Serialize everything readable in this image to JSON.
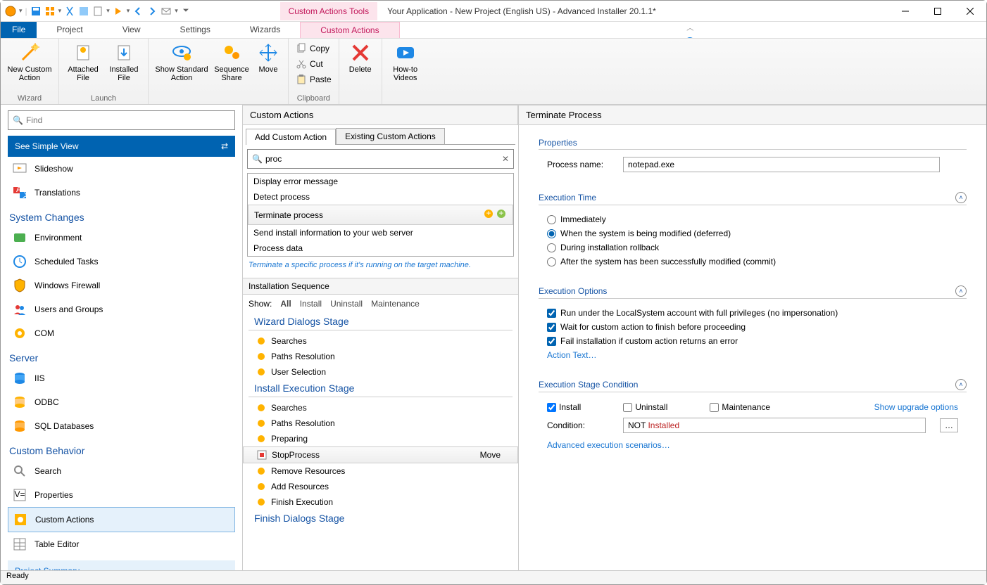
{
  "window": {
    "tools_tab": "Custom Actions Tools",
    "title": "Your Application - New Project (English US) - Advanced Installer 20.1.1*"
  },
  "menu": {
    "file": "File",
    "project": "Project",
    "view": "View",
    "settings": "Settings",
    "wizards": "Wizards",
    "custom_actions": "Custom Actions"
  },
  "ribbon": {
    "new_custom_action": "New Custom Action",
    "attached_file": "Attached File",
    "installed_file": "Installed File",
    "show_standard_action": "Show Standard Action",
    "sequence_share": "Sequence Share",
    "move": "Move",
    "copy": "Copy",
    "cut": "Cut",
    "paste": "Paste",
    "delete": "Delete",
    "howto": "How-to Videos",
    "grp_wizard": "Wizard",
    "grp_launch": "Launch",
    "grp_clipboard": "Clipboard"
  },
  "left": {
    "find_placeholder": "Find",
    "simple_view": "See Simple View",
    "slideshow": "Slideshow",
    "translations": "Translations",
    "h_system": "System Changes",
    "environment": "Environment",
    "scheduled": "Scheduled Tasks",
    "firewall": "Windows Firewall",
    "users": "Users and Groups",
    "com": "COM",
    "h_server": "Server",
    "iis": "IIS",
    "odbc": "ODBC",
    "sql": "SQL Databases",
    "h_custom": "Custom Behavior",
    "search": "Search",
    "properties": "Properties",
    "custom_actions": "Custom Actions",
    "table_editor": "Table Editor",
    "summary": "Project Summary"
  },
  "center": {
    "title": "Custom Actions",
    "tab_add": "Add Custom Action",
    "tab_existing": "Existing Custom Actions",
    "search_value": "proc",
    "items": {
      "0": "Display error message",
      "1": "Detect process",
      "2": "Terminate process",
      "3": "Send install information to your web server",
      "4": "Process data"
    },
    "hint": "Terminate a specific process if it's running on the target machine.",
    "seq_title": "Installation Sequence",
    "show_label": "Show:",
    "show_all": "All",
    "show_install": "Install",
    "show_uninstall": "Uninstall",
    "show_maint": "Maintenance",
    "stage_wizard": "Wizard Dialogs Stage",
    "w_searches": "Searches",
    "w_paths": "Paths Resolution",
    "w_user": "User Selection",
    "stage_install": "Install Execution Stage",
    "i_searches": "Searches",
    "i_paths": "Paths Resolution",
    "i_prep": "Preparing",
    "i_stop": "StopProcess",
    "i_move": "Move",
    "i_remove": "Remove Resources",
    "i_add": "Add Resources",
    "i_finish": "Finish Execution",
    "stage_finish": "Finish Dialogs Stage"
  },
  "right": {
    "title": "Terminate Process",
    "h_props": "Properties",
    "procname_lbl": "Process name:",
    "procname_val": "notepad.exe",
    "h_exectime": "Execution Time",
    "et_imm": "Immediately",
    "et_def": "When the system is being modified (deferred)",
    "et_roll": "During installation rollback",
    "et_commit": "After the system has been successfully modified (commit)",
    "h_execopts": "Execution Options",
    "eo_local": "Run under the LocalSystem account with full privileges (no impersonation)",
    "eo_wait": "Wait for custom action to finish before proceeding",
    "eo_fail": "Fail installation if custom action returns an error",
    "eo_action_text": "Action Text…",
    "h_stagecond": "Execution Stage Condition",
    "sc_install": "Install",
    "sc_uninstall": "Uninstall",
    "sc_maint": "Maintenance",
    "sc_upgrade": "Show upgrade options",
    "cond_lbl": "Condition:",
    "cond_not": "NOT ",
    "cond_installed": "Installed",
    "adv_scen": "Advanced execution scenarios…"
  },
  "status": "Ready"
}
